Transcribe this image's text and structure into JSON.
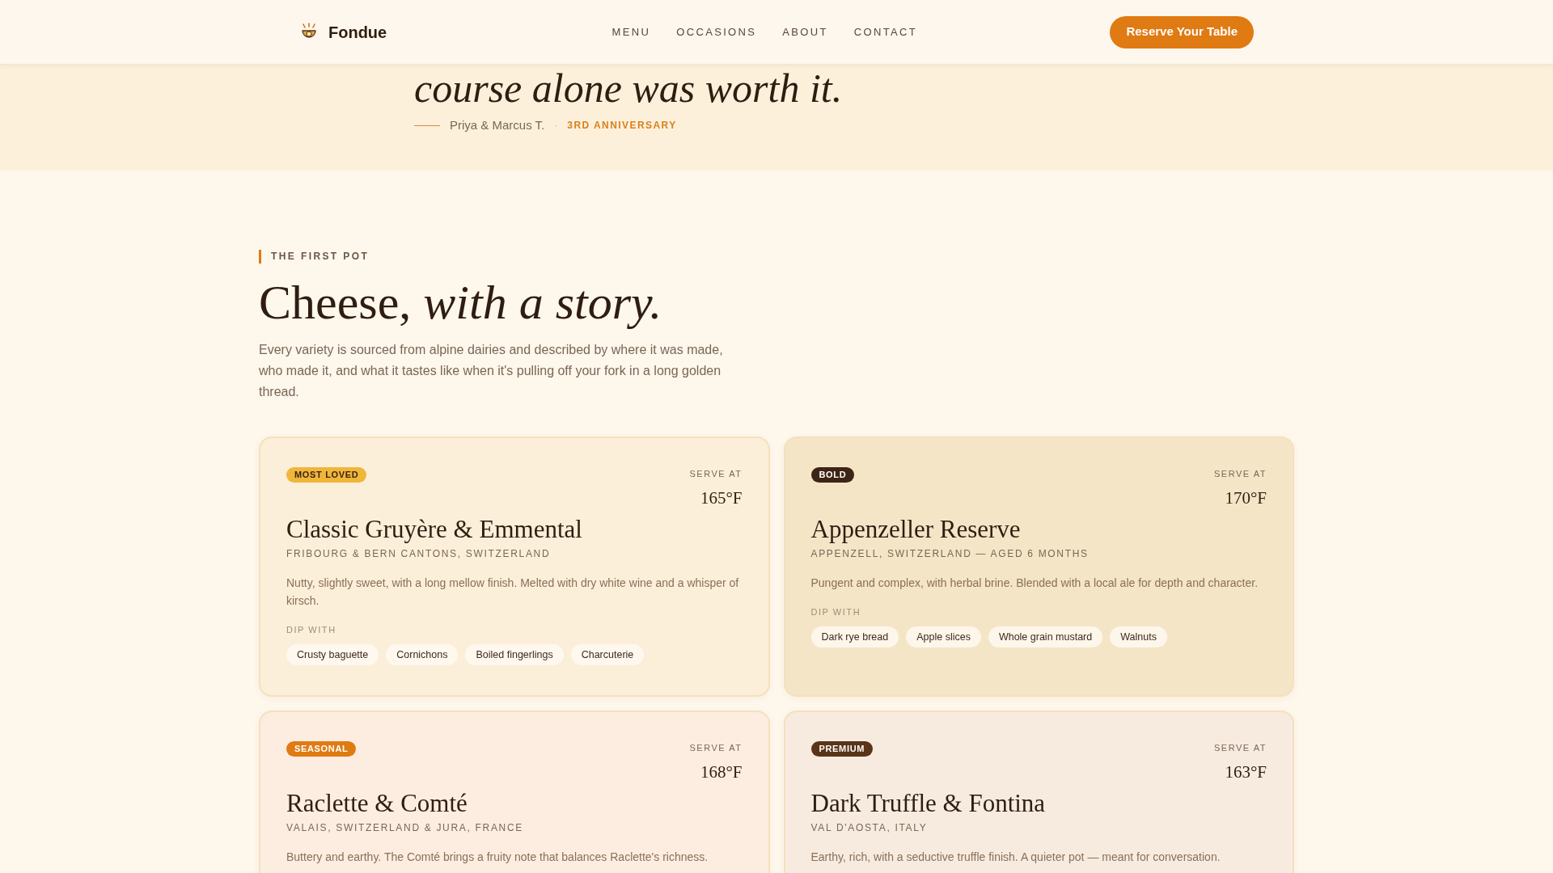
{
  "header": {
    "brand": "Fondue",
    "nav": [
      "MENU",
      "OCCASIONS",
      "ABOUT",
      "CONTACT"
    ],
    "cta": "Reserve Your Table"
  },
  "testimonial": {
    "quote": "course alone was worth it.",
    "author": "Priya & Marcus T.",
    "separator": "·",
    "occasion": "3RD ANNIVERSARY"
  },
  "section": {
    "eyebrow": "THE FIRST POT",
    "title_plain": "Cheese, ",
    "title_italic": "with a story.",
    "intro": "Every variety is sourced from alpine dairies and described by where it was made, who made it, and what it tastes like when it's pulling off your fork in a long golden thread."
  },
  "cards": [
    {
      "color": "#fcefd9",
      "badge": {
        "label": "MOST LOVED",
        "color": "#f0b63a"
      },
      "serve_label": "SERVE AT",
      "temp": "165°F",
      "name": "Classic Gruyère & Emmental",
      "origin": "FRIBOURG & BERN CANTONS, SWITZERLAND",
      "description": "Nutty, slightly sweet, with a long mellow finish. Melted with dry white wine and a whisper of kirsch.",
      "dip_label": "DIP WITH",
      "dips": [
        "Crusty baguette",
        "Cornichons",
        "Boiled fingerlings",
        "Charcuterie"
      ]
    },
    {
      "color": "#f5e5c7",
      "badge": {
        "label": "BOLD",
        "color": "#3d2414"
      },
      "serve_label": "SERVE AT",
      "temp": "170°F",
      "name": "Appenzeller Reserve",
      "origin": "APPENZELL, SWITZERLAND — AGED 6 MONTHS",
      "description": "Pungent and complex, with herbal brine. Blended with a local ale for depth and character.",
      "dip_label": "DIP WITH",
      "dips": [
        "Dark rye bread",
        "Apple slices",
        "Whole grain mustard",
        "Walnuts"
      ]
    },
    {
      "color": "#fcede0",
      "badge": {
        "label": "SEASONAL",
        "color": "#e07a12"
      },
      "serve_label": "SERVE AT",
      "temp": "168°F",
      "name": "Raclette & Comté",
      "origin": "VALAIS, SWITZERLAND & JURA, FRANCE",
      "description": "Buttery and earthy. The Comté brings a fruity note that balances Raclette's richness."
    },
    {
      "color": "#f7ebdf",
      "badge": {
        "label": "PREMIUM",
        "color": "#5a3418"
      },
      "serve_label": "SERVE AT",
      "temp": "163°F",
      "name": "Dark Truffle & Fontina",
      "origin": "VAL D'AOSTA, ITALY",
      "description": "Earthy, rich, with a seductive truffle finish. A quieter pot — meant for conversation."
    }
  ]
}
